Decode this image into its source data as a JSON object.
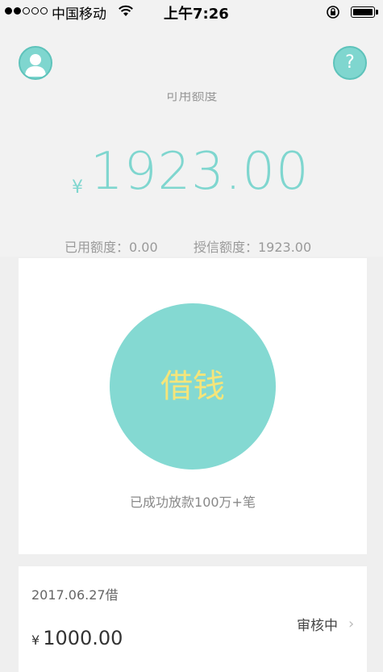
{
  "status_bar": {
    "signal_filled": 2,
    "signal_total": 5,
    "carrier": "中国移动",
    "time": "上午7:26"
  },
  "header": {
    "avatar_icon": "user-avatar-icon",
    "help_icon_glyph": "?",
    "available_label": "可用额度",
    "currency": "¥",
    "available_amount": "1923.00",
    "used_credit": "已用额度：0.00",
    "granted_credit": "授信额度：1923.00",
    "accent_color": "#7fd6cf"
  },
  "borrow": {
    "button_label": "借钱",
    "subtext": "已成功放款100万+笔",
    "button_color": "#84d9d2",
    "label_color": "#f5e57a"
  },
  "loan_record": {
    "date": "2017.06.27借",
    "currency": "¥",
    "amount": "1000.00",
    "status": "审核中",
    "chevron": "›"
  }
}
